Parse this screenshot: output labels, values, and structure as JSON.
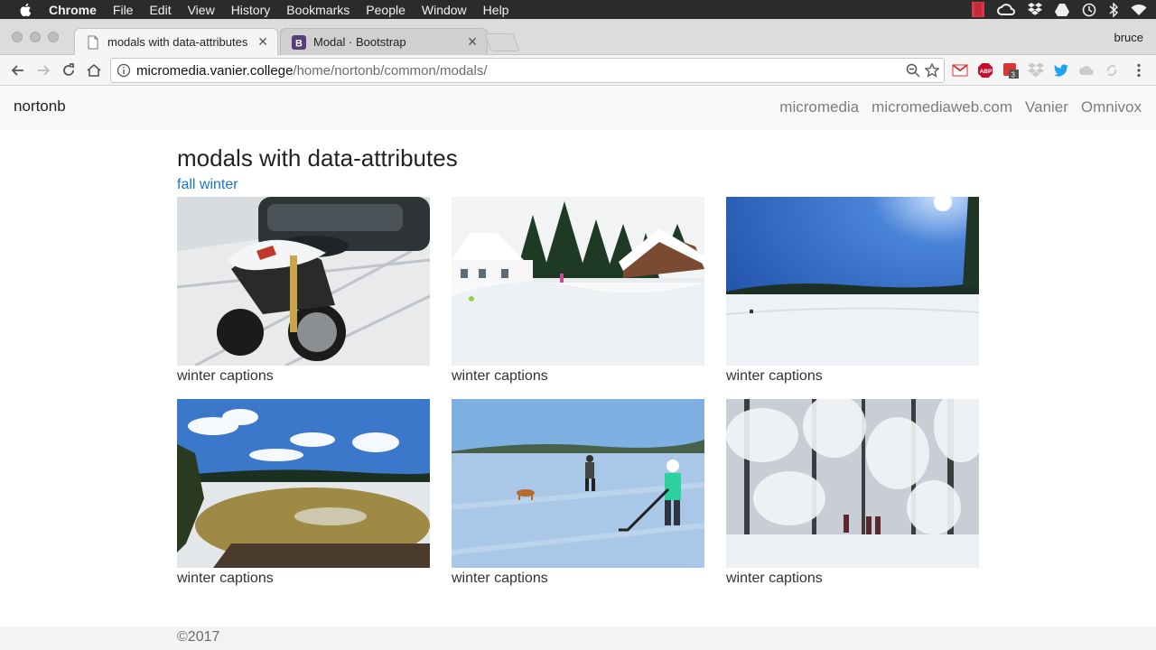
{
  "menubar": {
    "app": "Chrome",
    "items": [
      "File",
      "Edit",
      "View",
      "History",
      "Bookmarks",
      "People",
      "Window",
      "Help"
    ],
    "status_icons": [
      "red-block-icon",
      "creative-cloud-icon",
      "dropbox-icon",
      "drive-icon",
      "time-machine-icon",
      "bluetooth-icon",
      "wifi-icon"
    ]
  },
  "tabs": [
    {
      "title": "modals with data-attributes",
      "icon": "document-icon"
    },
    {
      "title": "Modal · Bootstrap",
      "icon": "bootstrap-icon",
      "badge": "B"
    }
  ],
  "profile": "bruce",
  "omnibox": {
    "host": "micromedia.vanier.college",
    "path": "/home/nortonb/common/modals/"
  },
  "extensions": {
    "badge": "3"
  },
  "site": {
    "brand": "nortonb",
    "nav": [
      "micromedia",
      "micromediaweb.com",
      "Vanier",
      "Omnivox"
    ],
    "title": "modals with data-attributes",
    "sublink": "fall winter",
    "cards": [
      {
        "caption": "winter captions",
        "scene": "snowy-motorcycle"
      },
      {
        "caption": "winter captions",
        "scene": "snowy-cabins"
      },
      {
        "caption": "winter captions",
        "scene": "frozen-lake-sunny"
      },
      {
        "caption": "winter captions",
        "scene": "melting-lake"
      },
      {
        "caption": "winter captions",
        "scene": "ice-hockey-dog"
      },
      {
        "caption": "winter captions",
        "scene": "snowy-forest-hikers"
      }
    ],
    "footer": "©2017"
  },
  "colors": {
    "link": "#1676c6",
    "navbar_bg": "#f8f8f9",
    "menubar_bg": "#2b2b2b"
  }
}
